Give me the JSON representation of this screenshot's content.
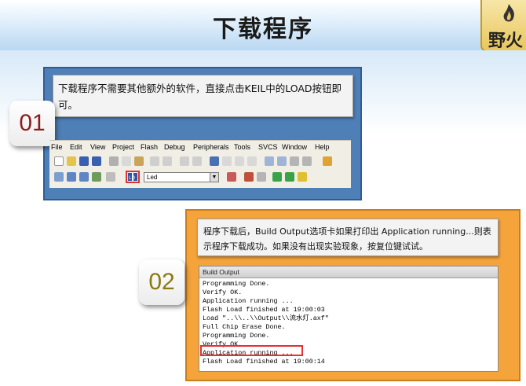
{
  "header": {
    "title": "下载程序",
    "logo_text": "野火"
  },
  "step1": {
    "number": "01",
    "note": "下载程序不需要其他额外的软件，直接点击KEIL中的LOAD按钮即可。",
    "menu": [
      "File",
      "Edit",
      "View",
      "Project",
      "Flash",
      "Debug",
      "Peripherals",
      "Tools",
      "SVCS",
      "Window",
      "Help"
    ],
    "target_value": "Led"
  },
  "step2": {
    "number": "02",
    "note": "程序下载后，Build Output选项卡如果打印出 Application running...则表示程序下载成功。如果没有出现实验现象，按复位键试试。",
    "window_title": "Build Output",
    "lines": [
      "Programming Done.",
      "Verify OK.",
      "Application running ...",
      "Flash Load finished at 19:00:03",
      "Load \"..\\\\..\\\\Output\\\\流水灯.axf\"",
      "Full Chip Erase Done.",
      "Programming Done.",
      "Verify OK.",
      "Application running ...",
      "Flash Load finished at 19:00:14"
    ]
  },
  "colors": {
    "panel1": "#4f7fb7",
    "panel2": "#f5a33b",
    "highlight": "#e53030",
    "badge1": "#8c1d1d",
    "badge2": "#8a7a10"
  }
}
